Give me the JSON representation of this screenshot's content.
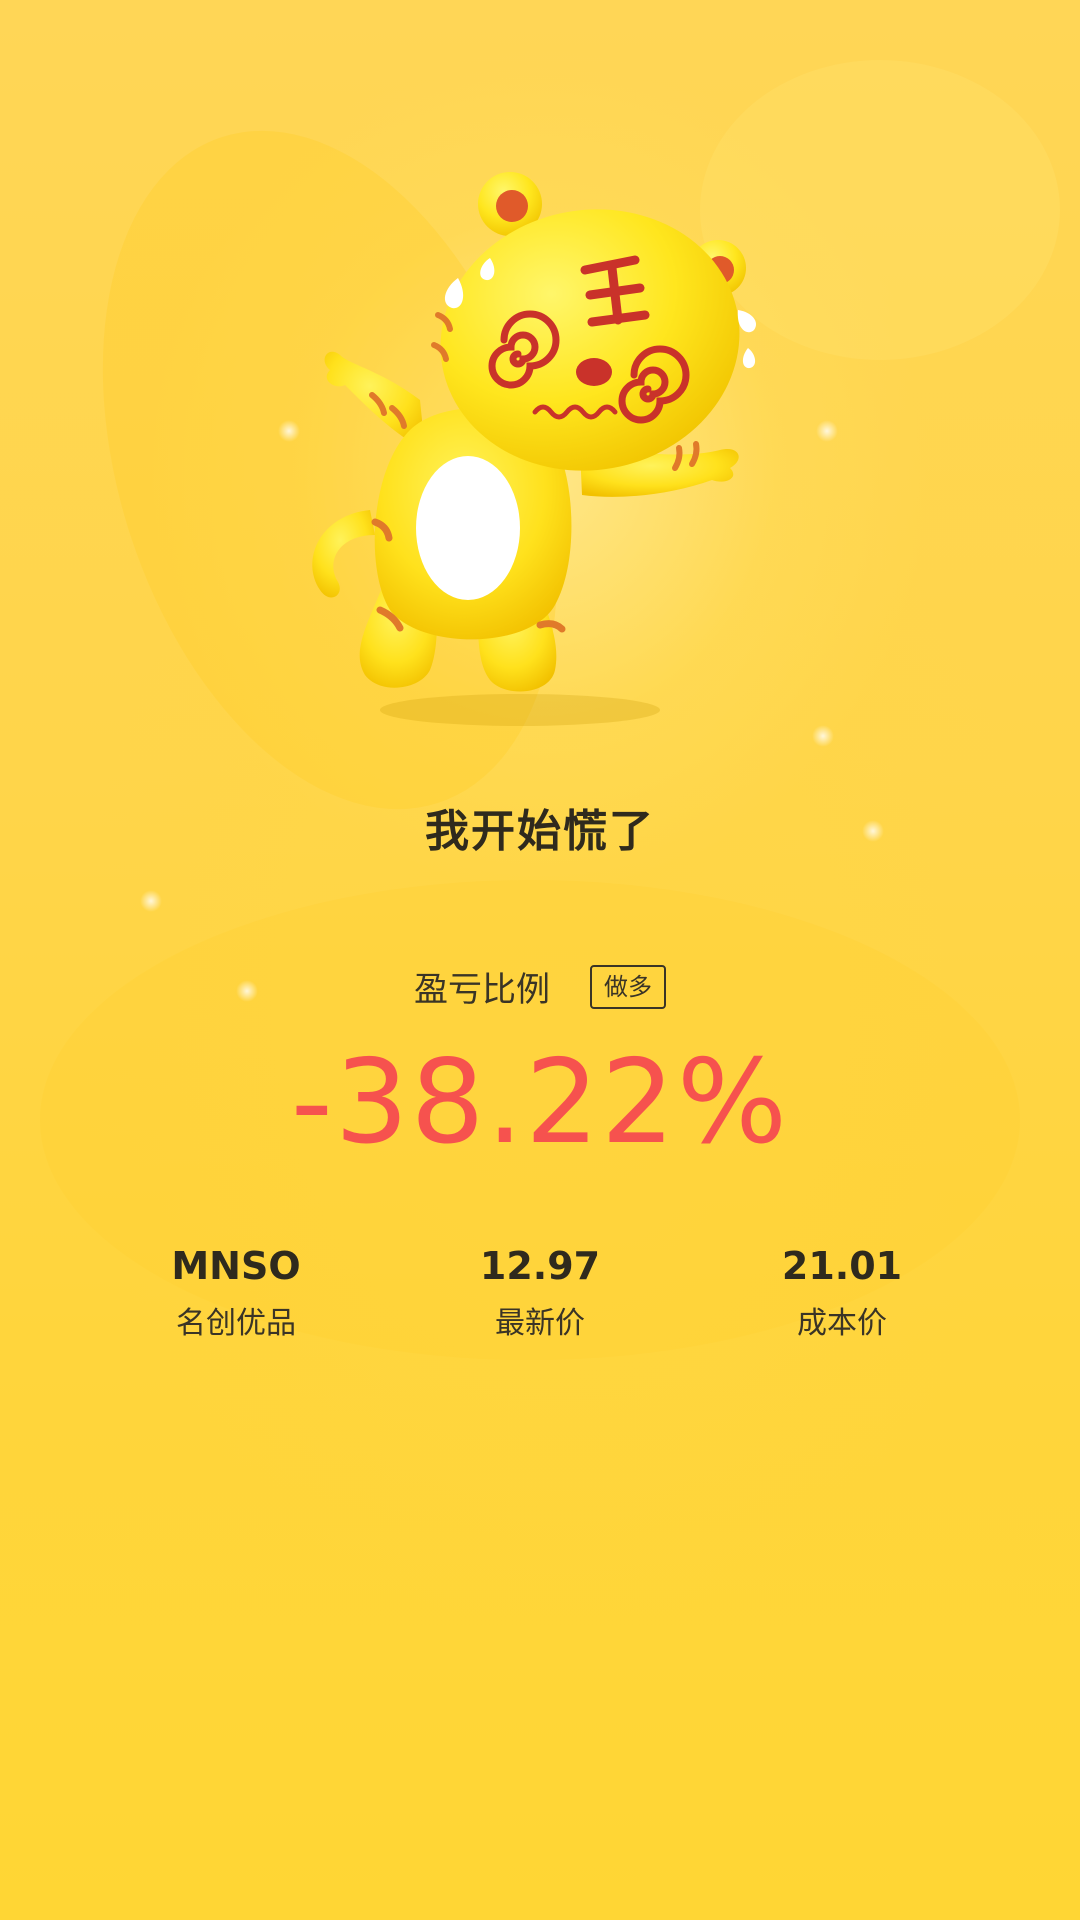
{
  "mood": {
    "title": "我开始慌了",
    "mascot_icon": "panicked-tiger-mascot"
  },
  "profit_loss": {
    "label": "盈亏比例",
    "position_tag": "做多",
    "value": "-38.22%",
    "value_color": "#F6524E"
  },
  "stats": [
    {
      "value": "MNSO",
      "label": "名创优品"
    },
    {
      "value": "12.97",
      "label": "最新价"
    },
    {
      "value": "21.01",
      "label": "成本价"
    }
  ],
  "theme": {
    "background": "#FFD54A",
    "text": "#2F2A1D"
  }
}
